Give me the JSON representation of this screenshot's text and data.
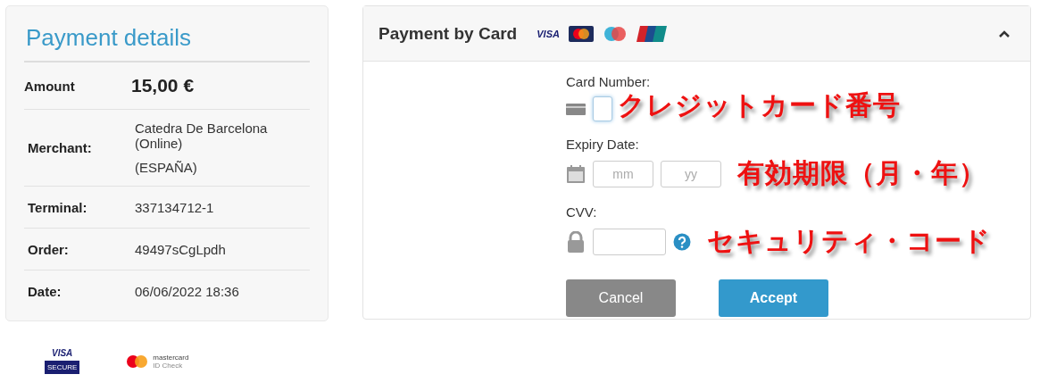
{
  "details": {
    "title": "Payment details",
    "rows": [
      {
        "label": "Amount",
        "value": "15,00 €",
        "kind": "amount"
      },
      {
        "label": "Merchant:",
        "value": "Catedra De Barcelona (Online)",
        "extra": "(ESPAÑA)",
        "kind": "text"
      },
      {
        "label": "Terminal:",
        "value": "337134712-1",
        "kind": "text"
      },
      {
        "label": "Order:",
        "value": "49497sCgLpdh",
        "kind": "text"
      },
      {
        "label": "Date:",
        "value": "06/06/2022  18:36",
        "kind": "text"
      }
    ]
  },
  "card_logos": {
    "visa": "VISA"
  },
  "payment": {
    "title": "Payment by Card",
    "expanded": true,
    "card_number": {
      "label": "Card Number:",
      "annotation": "クレジットカード番号"
    },
    "expiry": {
      "label": "Expiry Date:",
      "month_placeholder": "mm",
      "year_placeholder": "yy",
      "annotation": "有効期限（月・年）"
    },
    "cvv": {
      "label": "CVV:",
      "annotation": "セキュリティ・コード"
    },
    "buttons": [
      {
        "label": "Cancel",
        "kind": "secondary"
      },
      {
        "label": "Accept",
        "kind": "primary"
      }
    ]
  },
  "footer_logos": {
    "visa_top": "VISA",
    "visa_bottom": "SECURE",
    "mastercard_top": "mastercard",
    "mastercard_bottom": "ID Check"
  }
}
